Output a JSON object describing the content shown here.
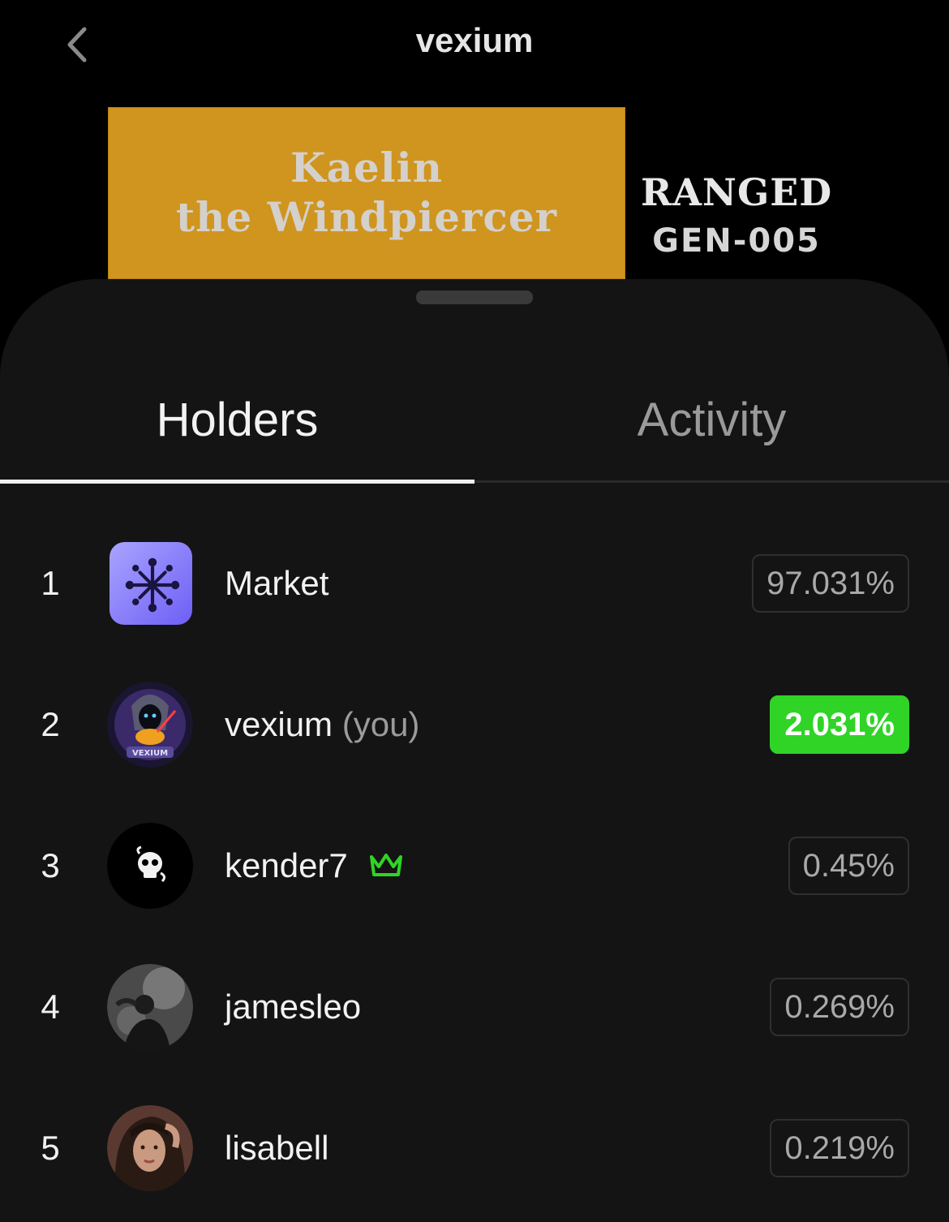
{
  "header": {
    "title": "vexium",
    "back_icon": "chevron-left-icon"
  },
  "card": {
    "name_line1": "Kaelin",
    "name_line2": "the Windpiercer",
    "class": "RANGED",
    "gen": "GEN-005",
    "banner_color": "#cf951f"
  },
  "tabs": [
    {
      "label": "Holders",
      "active": true
    },
    {
      "label": "Activity",
      "active": false
    }
  ],
  "holders": [
    {
      "rank": "1",
      "name": "Market",
      "suffix": "",
      "pct": "97.031%",
      "avatar": "market-logo-icon"
    },
    {
      "rank": "2",
      "name": "vexium",
      "suffix": "(you)",
      "pct": "2.031%",
      "avatar": "vexium-avatar",
      "highlight": true
    },
    {
      "rank": "3",
      "name": "kender7",
      "suffix": "",
      "pct": "0.45%",
      "avatar": "skull-avatar",
      "badge": "crown-icon"
    },
    {
      "rank": "4",
      "name": "jamesleo",
      "suffix": "",
      "pct": "0.269%",
      "avatar": "photo-avatar"
    },
    {
      "rank": "5",
      "name": "lisabell",
      "suffix": "",
      "pct": "0.219%",
      "avatar": "photo-avatar"
    }
  ],
  "colors": {
    "accent_green": "#2fd426",
    "sheet_bg": "#141414"
  }
}
